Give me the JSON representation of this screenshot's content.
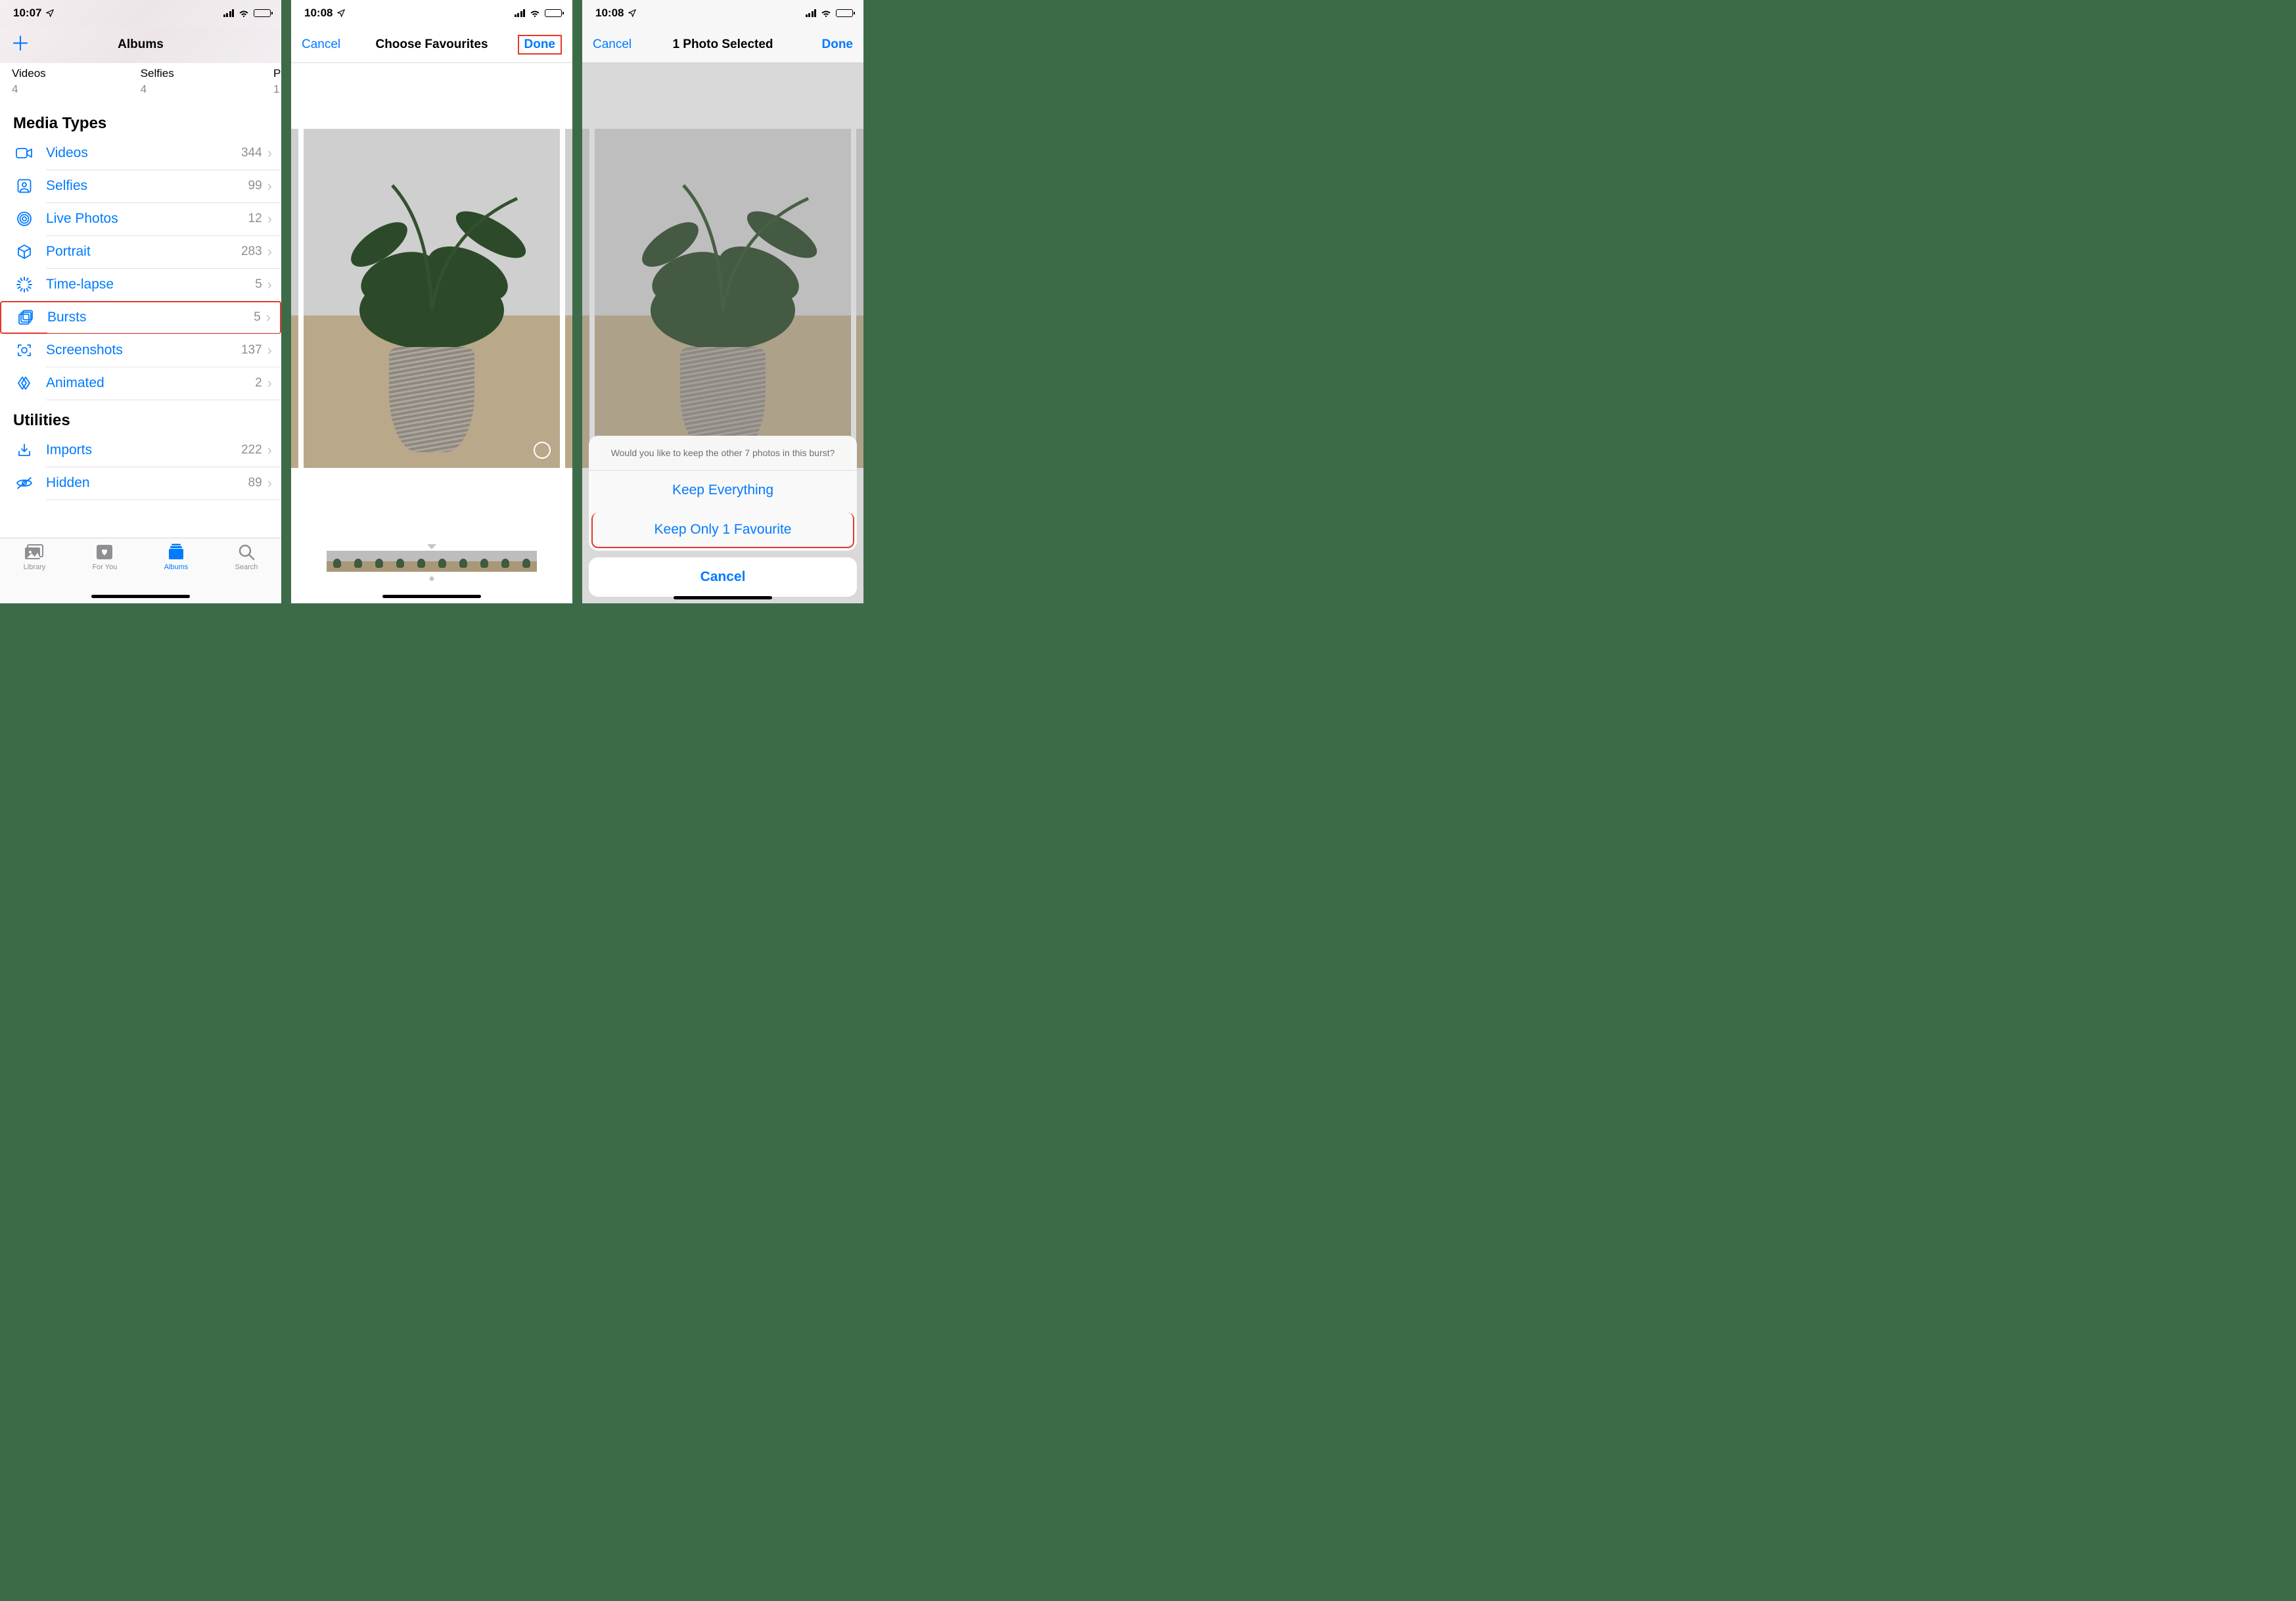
{
  "screen1": {
    "status": {
      "time": "10:07"
    },
    "nav": {
      "title": "Albums"
    },
    "thumbs": [
      {
        "label": "Videos",
        "count": "4"
      },
      {
        "label": "Selfies",
        "count": "4"
      },
      {
        "label": "P",
        "count": "1"
      }
    ],
    "sections": {
      "media_types": {
        "title": "Media Types"
      },
      "utilities": {
        "title": "Utilities"
      }
    },
    "media_items": [
      {
        "label": "Videos",
        "count": "344",
        "icon": "video-camera-icon"
      },
      {
        "label": "Selfies",
        "count": "99",
        "icon": "person-square-icon"
      },
      {
        "label": "Live Photos",
        "count": "12",
        "icon": "concentric-circles-icon"
      },
      {
        "label": "Portrait",
        "count": "283",
        "icon": "cube-icon"
      },
      {
        "label": "Time-lapse",
        "count": "5",
        "icon": "timelapse-icon"
      },
      {
        "label": "Bursts",
        "count": "5",
        "icon": "photo-stack-icon"
      },
      {
        "label": "Screenshots",
        "count": "137",
        "icon": "screenshot-icon"
      },
      {
        "label": "Animated",
        "count": "2",
        "icon": "diamond-stack-icon"
      }
    ],
    "utilities_items": [
      {
        "label": "Imports",
        "count": "222",
        "icon": "import-icon"
      },
      {
        "label": "Hidden",
        "count": "89",
        "icon": "eye-slash-icon"
      }
    ],
    "highlighted_item_index": 5,
    "tabs": [
      {
        "label": "Library",
        "icon": "photo-stack-icon"
      },
      {
        "label": "For You",
        "icon": "heart-card-icon"
      },
      {
        "label": "Albums",
        "icon": "albums-icon"
      },
      {
        "label": "Search",
        "icon": "search-icon"
      }
    ],
    "active_tab_index": 2
  },
  "screen2": {
    "status": {
      "time": "10:08"
    },
    "nav": {
      "left": "Cancel",
      "title": "Choose Favourites",
      "right": "Done"
    },
    "highlight_done": true,
    "filmstrip_count": 10
  },
  "screen3": {
    "status": {
      "time": "10:08"
    },
    "nav": {
      "left": "Cancel",
      "title": "1 Photo Selected",
      "right": "Done"
    },
    "sheet": {
      "message": "Would you like to keep the other 7 photos in this burst?",
      "option1": "Keep Everything",
      "option2": "Keep Only 1 Favourite",
      "cancel": "Cancel"
    },
    "highlight_option2": true
  }
}
